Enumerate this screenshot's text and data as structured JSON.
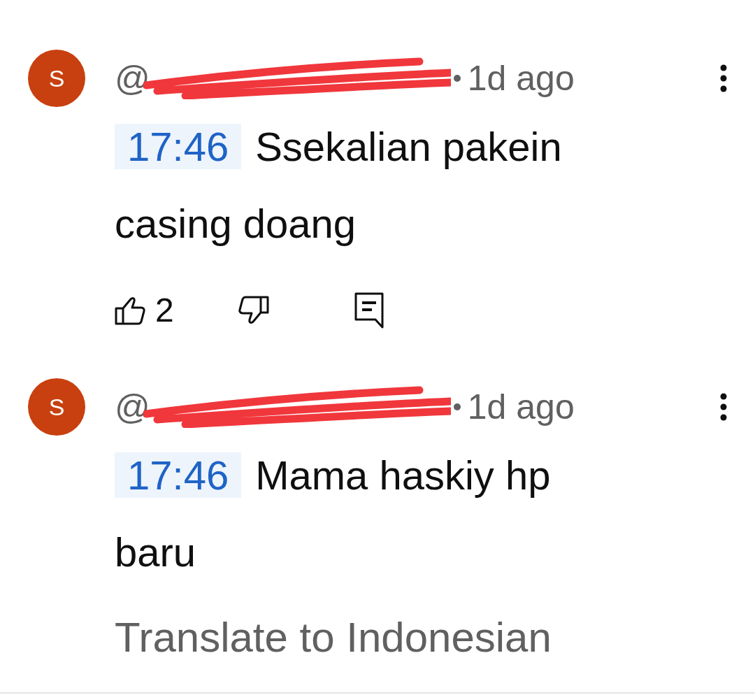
{
  "comments": [
    {
      "avatar": "S",
      "author": "@",
      "time": "1d ago",
      "timestamp": "17:46",
      "text_lines": [
        "Ssekalian pakein",
        "casing doang"
      ],
      "likes": "2"
    },
    {
      "avatar": "S",
      "author": "@",
      "time": "1d ago",
      "timestamp": "17:46",
      "text_lines": [
        "Mama haskiy hp",
        "baru"
      ],
      "translate": "Translate to Indonesian"
    }
  ]
}
